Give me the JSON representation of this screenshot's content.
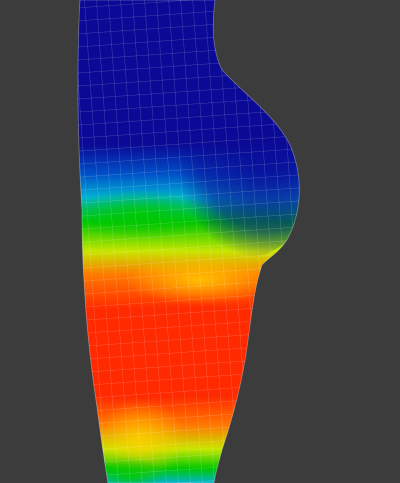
{
  "viewport": {
    "background_color": "#3c3c3c",
    "mesh": {
      "subject": "body-mesh",
      "wireframe": true,
      "wire_color": "#ffffff",
      "colormap": [
        "#0a0a96",
        "#0050c8",
        "#00b4d2",
        "#00c800",
        "#c8e600",
        "#ffd200",
        "#ff7800",
        "#ff2a00"
      ]
    }
  }
}
